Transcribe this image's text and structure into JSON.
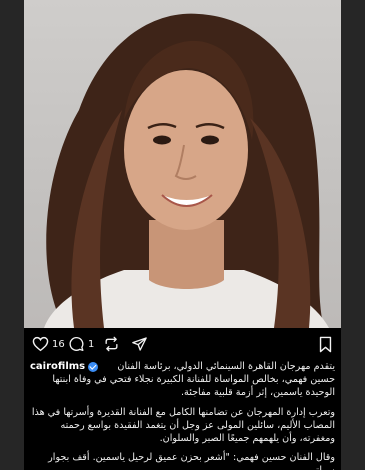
{
  "post": {
    "username": "cairofilms",
    "likes": "16",
    "comments": "1",
    "caption_line1": "يتقدم مهرجان القاهرة السينمائي الدولي، برئاسة الفنان حسين فهمي، بخالص المواساة للفنانة الكبيرة نجلاء فتحي في وفاة ابنتها الوحيدة ياسمين، إثر أزمة قلبية مفاجئة.",
    "caption_para2": "وتعرب إدارة المهرجان عن تضامنها الكامل مع الفنانة القديرة وأسرتها في هذا المصاب الأليم، سائلين المولى عز وجل أن يتغمد الفقيدة بواسع رحمته ومغفرته، وأن يلهمهم جميعًا الصبر والسلوان.",
    "caption_para3": "وقال الفنان حسين فهمي: \"أشعر بحزن عميق لرحيل ياسمين. أقف بجوار زميلتي"
  },
  "icons": {
    "like": "heart-icon",
    "comment": "comment-icon",
    "repost": "repost-icon",
    "share": "send-icon",
    "save": "bookmark-icon"
  },
  "colors": {
    "background": "#000000",
    "text": "#f0f0f0",
    "verified": "#3b8df5"
  }
}
